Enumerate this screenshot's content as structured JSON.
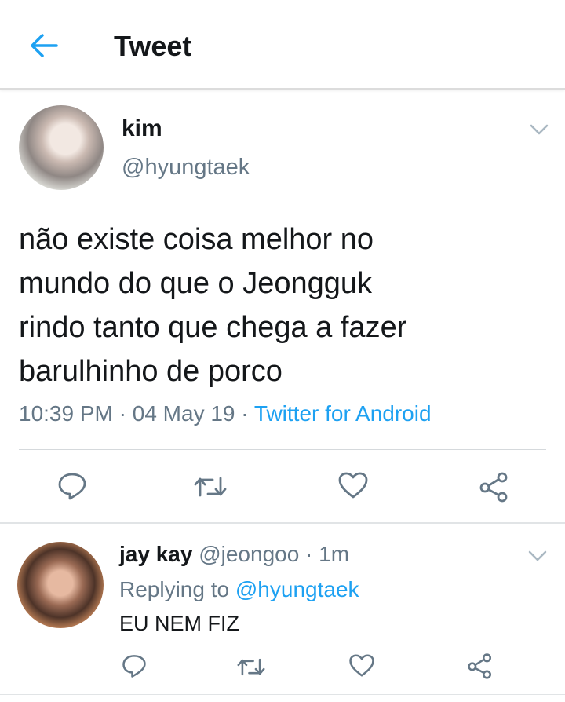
{
  "header": {
    "title": "Tweet",
    "back_icon": "arrow-left-icon",
    "accent": "#1da1f2"
  },
  "tweet": {
    "author_name": "kim",
    "author_handle": "@hyungtaek",
    "text": "não existe coisa melhor no\nmundo do que o Jeongguk\nrindo tanto que chega a fazer\nbarulhinho de porco",
    "time": "10:39 PM",
    "sep1": " · ",
    "date": "04 May 19",
    "sep2": " · ",
    "source": "Twitter for Android",
    "actions": [
      "reply-icon",
      "retweet-icon",
      "like-icon",
      "share-icon"
    ]
  },
  "reply": {
    "author_name": "jay kay",
    "author_handle": "@jeongoo · 1m",
    "replying_prefix": "Replying to ",
    "replying_to": "@hyungtaek",
    "text": "EU NEM FIZ",
    "actions": [
      "reply-icon",
      "retweet-icon",
      "like-icon",
      "share-icon"
    ]
  },
  "colors": {
    "text": "#14171a",
    "secondary": "#657786",
    "link": "#1da1f2"
  }
}
